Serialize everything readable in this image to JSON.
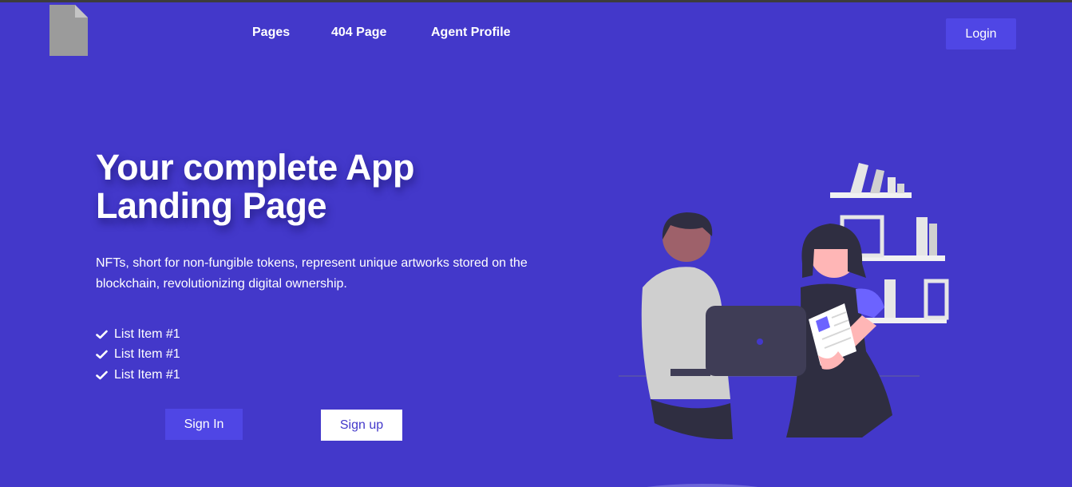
{
  "header": {
    "logo_icon": "file-icon",
    "nav": [
      {
        "label": "Pages"
      },
      {
        "label": "404 Page"
      },
      {
        "label": "Agent Profile"
      }
    ],
    "login_label": "Login"
  },
  "hero": {
    "title": "Your complete App Landing Page",
    "description": "NFTs, short for non-fungible tokens, represent unique artworks stored on the blockchain, revolutionizing digital ownership.",
    "list": [
      {
        "icon": "check-icon",
        "label": "List Item #1"
      },
      {
        "icon": "check-icon",
        "label": "List Item #1"
      },
      {
        "icon": "check-icon",
        "label": "List Item #1"
      }
    ],
    "signin_label": "Sign In",
    "signup_label": "Sign up"
  },
  "colors": {
    "background": "#4338ca",
    "accent_button": "#4f46e5",
    "text": "#ffffff"
  }
}
